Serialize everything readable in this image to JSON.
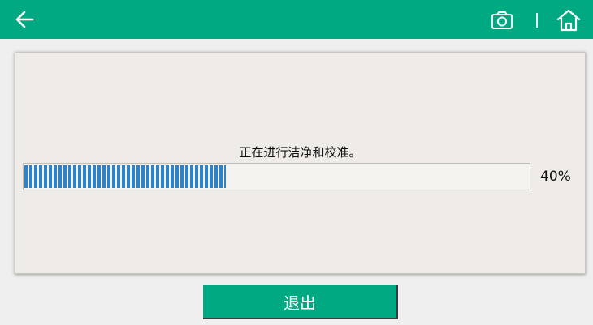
{
  "header": {
    "back_icon": "arrow-left-icon",
    "camera_icon": "camera-icon",
    "home_icon": "home-icon",
    "background_color": "#00a982"
  },
  "main": {
    "status_text": "正在进行洁净和校准。",
    "progress": {
      "value_fraction": 0.4,
      "percent_label": "40%",
      "bar_color": "#2e82c8"
    }
  },
  "footer": {
    "exit_label": "退出"
  }
}
